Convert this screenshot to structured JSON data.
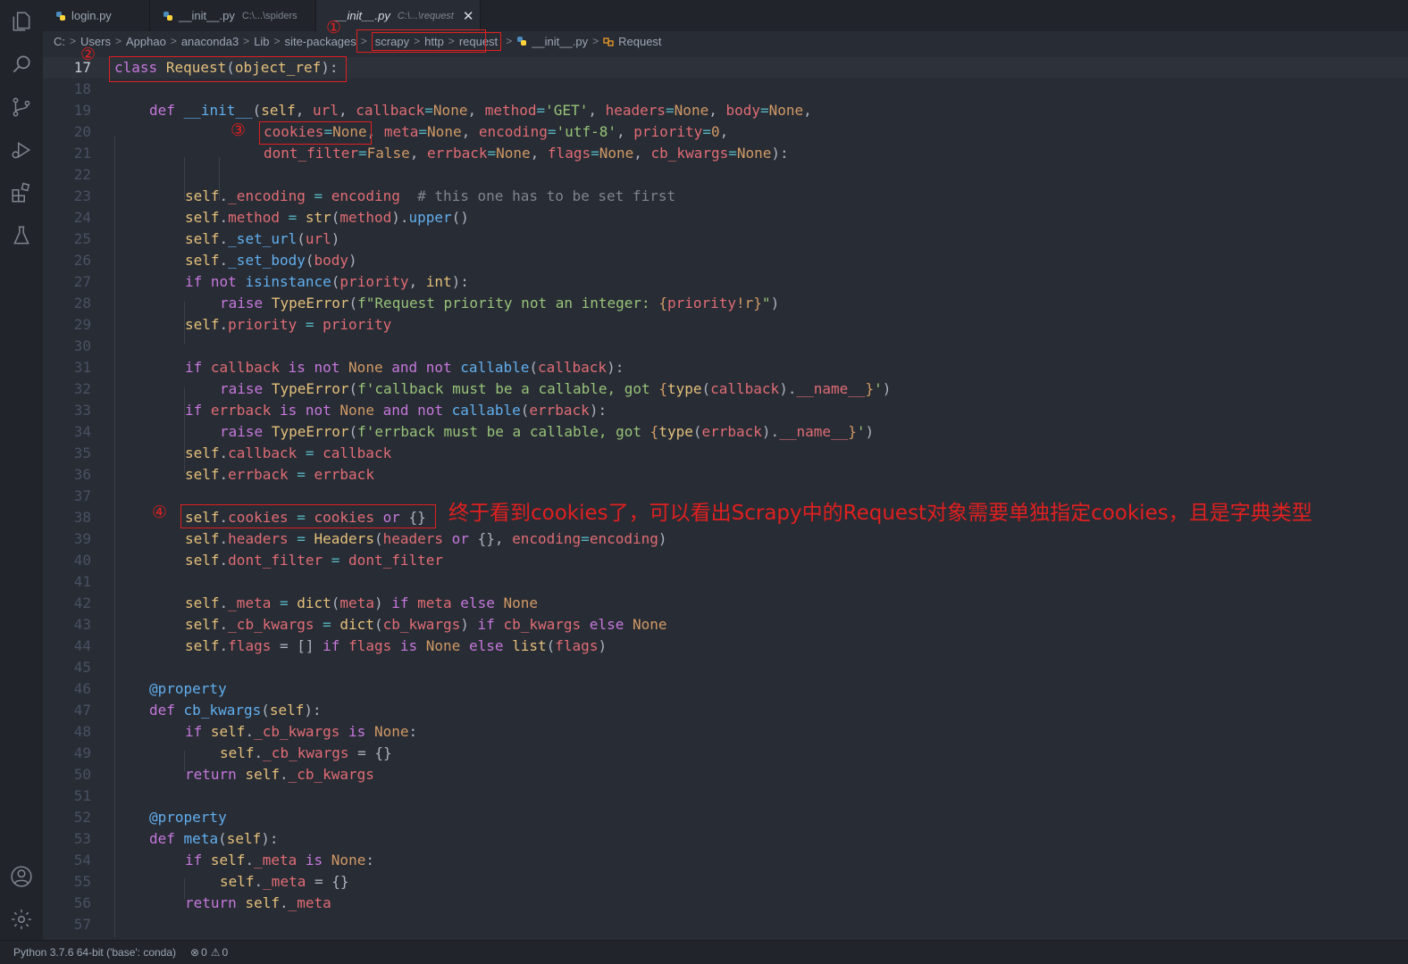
{
  "tabs": [
    {
      "name": "login.py",
      "path": "",
      "active": false
    },
    {
      "name": "__init__.py",
      "path": "C:\\...\\spiders",
      "active": false
    },
    {
      "name": "__init__.py",
      "path": "C:\\...\\request",
      "active": true
    }
  ],
  "close_glyph": "✕",
  "breadcrumb": {
    "pre": [
      "C:",
      "Users",
      "Apphao",
      "anaconda3",
      "Lib",
      "site-packages"
    ],
    "boxed": [
      "scrapy",
      "http",
      "request"
    ],
    "file": "__init__.py",
    "symbol": "Request"
  },
  "annotations": {
    "c1": "①",
    "c2": "②",
    "c3": "③",
    "c4": "④",
    "note": "终于看到cookies了，可以看出Scrapy中的Request对象需要单独指定cookies，且是字典类型"
  },
  "line_numbers": [
    "17",
    "18",
    "19",
    "20",
    "21",
    "22",
    "23",
    "24",
    "25",
    "26",
    "27",
    "28",
    "29",
    "30",
    "31",
    "32",
    "33",
    "34",
    "35",
    "36",
    "37",
    "38",
    "39",
    "40",
    "41",
    "42",
    "43",
    "44",
    "45",
    "46",
    "47",
    "48",
    "49",
    "50",
    "51",
    "52",
    "53",
    "54",
    "55",
    "56",
    "57"
  ],
  "code": {
    "l17": {
      "a": "class",
      "b": " ",
      "c": "Request",
      "d": "(",
      "e": "object_ref",
      "f": "):"
    },
    "l19": {
      "a": "def",
      "b": " ",
      "c": "__init__",
      "d": "(",
      "e": "self",
      "f": ", ",
      "g": "url",
      "h": ", ",
      "i": "callback",
      "j": "=",
      "k": "None",
      "l": ", ",
      "m": "method",
      "n": "=",
      "o": "'GET'",
      "p": ", ",
      "q": "headers",
      "r": "=",
      "s": "None",
      "t": ", ",
      "u": "body",
      "v": "=",
      "w": "None",
      "x": ","
    },
    "l20": {
      "a": "cookies",
      "b": "=",
      "c": "None",
      "d": ", ",
      "e": "meta",
      "f": "=",
      "g": "None",
      "h": ", ",
      "i": "encoding",
      "j": "=",
      "k": "'utf-8'",
      "l": ", ",
      "m": "priority",
      "n": "=",
      "o": "0",
      "p": ","
    },
    "l21": {
      "a": "dont_filter",
      "b": "=",
      "c": "False",
      "d": ", ",
      "e": "errback",
      "f": "=",
      "g": "None",
      "h": ", ",
      "i": "flags",
      "j": "=",
      "k": "None",
      "l": ", ",
      "m": "cb_kwargs",
      "n": "=",
      "o": "None",
      "p": "):"
    },
    "l23": {
      "a": "self",
      "b": ".",
      "c": "_encoding",
      "d": " = ",
      "e": "encoding",
      "f": "  ",
      "g": "# this one has to be set first"
    },
    "l24": {
      "a": "self",
      "b": ".",
      "c": "method",
      "d": " = ",
      "e": "str",
      "f": "(",
      "g": "method",
      "h": ").",
      "i": "upper",
      "j": "()"
    },
    "l25": {
      "a": "self",
      "b": ".",
      "c": "_set_url",
      "d": "(",
      "e": "url",
      "f": ")"
    },
    "l26": {
      "a": "self",
      "b": ".",
      "c": "_set_body",
      "d": "(",
      "e": "body",
      "f": ")"
    },
    "l27": {
      "a": "if",
      "b": " ",
      "c": "not",
      "d": " ",
      "e": "isinstance",
      "f": "(",
      "g": "priority",
      "h": ", ",
      "i": "int",
      "j": "):"
    },
    "l28": {
      "a": "raise",
      "b": " ",
      "c": "TypeError",
      "d": "(",
      "e": "f\"Request priority not an integer: ",
      "f": "{",
      "g": "priority",
      "h": "!r",
      "i": "}",
      "j": "\"",
      "k": ")"
    },
    "l29": {
      "a": "self",
      "b": ".",
      "c": "priority",
      "d": " = ",
      "e": "priority"
    },
    "l31": {
      "a": "if",
      "b": " ",
      "c": "callback",
      "d": " ",
      "e": "is not",
      "f": " ",
      "g": "None",
      "h": " ",
      "i": "and not",
      "j": " ",
      "k": "callable",
      "l": "(",
      "m": "callback",
      "n": "):"
    },
    "l32": {
      "a": "raise",
      "b": " ",
      "c": "TypeError",
      "d": "(",
      "e": "f'callback must be a callable, got ",
      "f": "{",
      "g": "type",
      "h": "(",
      "i": "callback",
      "j": ").",
      "k": "__name__",
      "l": "}",
      "m": "'",
      "n": ")"
    },
    "l33": {
      "a": "if",
      "b": " ",
      "c": "errback",
      "d": " ",
      "e": "is not",
      "f": " ",
      "g": "None",
      "h": " ",
      "i": "and not",
      "j": " ",
      "k": "callable",
      "l": "(",
      "m": "errback",
      "n": "):"
    },
    "l34": {
      "a": "raise",
      "b": " ",
      "c": "TypeError",
      "d": "(",
      "e": "f'errback must be a callable, got ",
      "f": "{",
      "g": "type",
      "h": "(",
      "i": "errback",
      "j": ").",
      "k": "__name__",
      "l": "}",
      "m": "'",
      "n": ")"
    },
    "l35": {
      "a": "self",
      "b": ".",
      "c": "callback",
      "d": " = ",
      "e": "callback"
    },
    "l36": {
      "a": "self",
      "b": ".",
      "c": "errback",
      "d": " = ",
      "e": "errback"
    },
    "l38": {
      "a": "self",
      "b": ".",
      "c": "cookies",
      "d": " = ",
      "e": "cookies",
      "f": " ",
      "g": "or",
      "h": " {}"
    },
    "l39": {
      "a": "self",
      "b": ".",
      "c": "headers",
      "d": " = ",
      "e": "Headers",
      "f": "(",
      "g": "headers",
      "h": " ",
      "i": "or",
      "j": " {}, ",
      "k": "encoding",
      "l": "=",
      "m": "encoding",
      "n": ")"
    },
    "l40": {
      "a": "self",
      "b": ".",
      "c": "dont_filter",
      "d": " = ",
      "e": "dont_filter"
    },
    "l42": {
      "a": "self",
      "b": ".",
      "c": "_meta",
      "d": " = ",
      "e": "dict",
      "f": "(",
      "g": "meta",
      "h": ") ",
      "i": "if",
      "j": " ",
      "k": "meta",
      "l": " ",
      "m": "else",
      "n": " ",
      "o": "None"
    },
    "l43": {
      "a": "self",
      "b": ".",
      "c": "_cb_kwargs",
      "d": " = ",
      "e": "dict",
      "f": "(",
      "g": "cb_kwargs",
      "h": ") ",
      "i": "if",
      "j": " ",
      "k": "cb_kwargs",
      "l": " ",
      "m": "else",
      "n": " ",
      "o": "None"
    },
    "l44": {
      "a": "self",
      "b": ".",
      "c": "flags",
      "d": " = [] ",
      "e": "if",
      "f": " ",
      "g": "flags",
      "h": " ",
      "i": "is",
      "j": " ",
      "k": "None",
      "l": " ",
      "m": "else",
      "n": " ",
      "o": "list",
      "p": "(",
      "q": "flags",
      "r": ")"
    },
    "l46": {
      "a": "@property"
    },
    "l47": {
      "a": "def",
      "b": " ",
      "c": "cb_kwargs",
      "d": "(",
      "e": "self",
      "f": "):"
    },
    "l48": {
      "a": "if",
      "b": " ",
      "c": "self",
      "d": ".",
      "e": "_cb_kwargs",
      "f": " ",
      "g": "is",
      "h": " ",
      "i": "None",
      "j": ":"
    },
    "l49": {
      "a": "self",
      "b": ".",
      "c": "_cb_kwargs",
      "d": " = {}"
    },
    "l50": {
      "a": "return",
      "b": " ",
      "c": "self",
      "d": ".",
      "e": "_cb_kwargs"
    },
    "l52": {
      "a": "@property"
    },
    "l53": {
      "a": "def",
      "b": " ",
      "c": "meta",
      "d": "(",
      "e": "self",
      "f": "):"
    },
    "l54": {
      "a": "if",
      "b": " ",
      "c": "self",
      "d": ".",
      "e": "_meta",
      "f": " ",
      "g": "is",
      "h": " ",
      "i": "None",
      "j": ":"
    },
    "l55": {
      "a": "self",
      "b": ".",
      "c": "_meta",
      "d": " = {}"
    },
    "l56": {
      "a": "return",
      "b": " ",
      "c": "self",
      "d": ".",
      "e": "_meta"
    }
  },
  "status": {
    "interpreter": "Python 3.7.6 64-bit ('base': conda)",
    "errors": "0",
    "warnings": "0",
    "err_glyph": "⊗",
    "warn_glyph": "⚠"
  },
  "colors": {
    "annotation": "#e02020",
    "background": "#282c34"
  }
}
